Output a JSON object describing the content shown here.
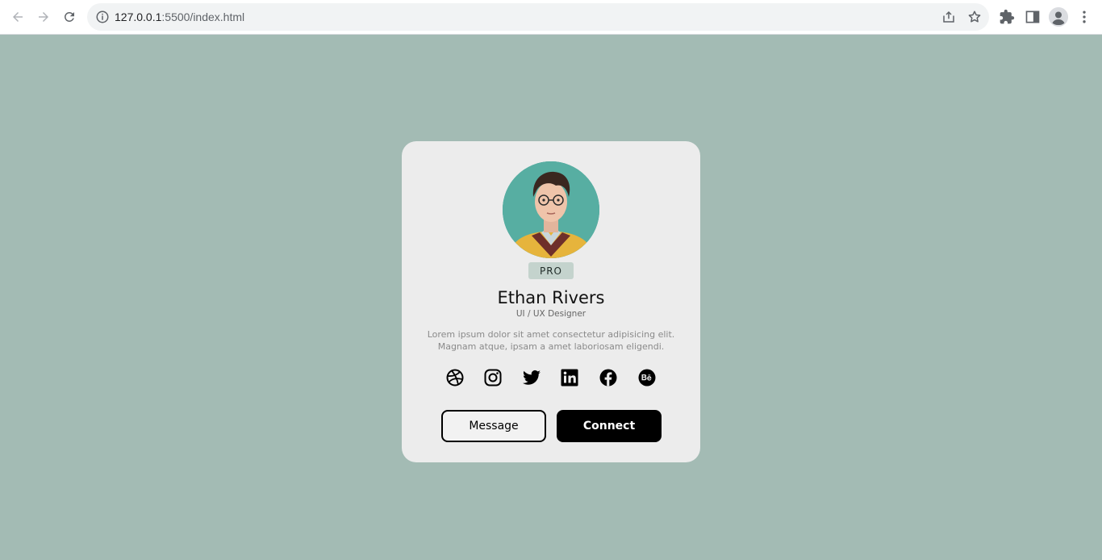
{
  "browser": {
    "url_host": "127.0.0.1",
    "url_path": ":5500/index.html",
    "icons": [
      "back-icon",
      "forward-icon",
      "reload-icon",
      "info-icon",
      "share-icon",
      "star-icon",
      "extensions-icon",
      "side-panel-icon",
      "profile-icon",
      "menu-icon"
    ]
  },
  "colors": {
    "page_background": "#a3bbb4",
    "card_background": "#ececec",
    "badge_background": "#c4d3cd",
    "connect_button": "#000000"
  },
  "profile": {
    "badge": "PRO",
    "name": "Ethan Rivers",
    "role": "UI / UX Designer",
    "bio_line1": "Lorem ipsum dolor sit amet consectetur adipisicing elit.",
    "bio_line2": "Magnam atque, ipsam a amet laboriosam eligendi."
  },
  "social": [
    "dribbble-icon",
    "instagram-icon",
    "twitter-icon",
    "linkedin-icon",
    "facebook-icon",
    "behance-icon"
  ],
  "actions": {
    "message_label": "Message",
    "connect_label": "Connect"
  }
}
